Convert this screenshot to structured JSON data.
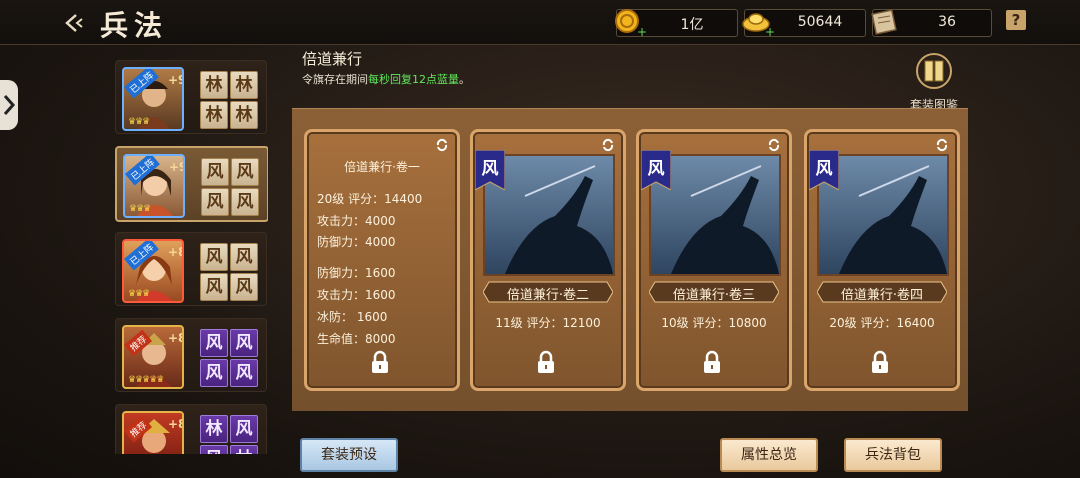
{
  "header": {
    "title": "兵法",
    "back_icon": "back-arrow-icon",
    "help_label": "?"
  },
  "currencies": [
    {
      "icon": "gold-coin-icon",
      "value": "1亿"
    },
    {
      "icon": "gold-ingot-icon",
      "value": "50644"
    },
    {
      "icon": "scroll-icon",
      "value": "36"
    }
  ],
  "heroes": [
    {
      "badge": "已上阵",
      "level": "+9",
      "stars": "♛♛♛",
      "frame": "blue",
      "tiles": [
        "林",
        "林",
        "林",
        "林"
      ],
      "tile_style": "gold"
    },
    {
      "badge": "已上阵",
      "level": "+9",
      "stars": "♛♛♛",
      "frame": "blue",
      "tiles": [
        "风",
        "风",
        "风",
        "风"
      ],
      "tile_style": "gold"
    },
    {
      "badge": "已上阵",
      "level": "+8",
      "stars": "♛♛♛",
      "frame": "red",
      "tiles": [
        "风",
        "风",
        "风",
        "风"
      ],
      "tile_style": "gold"
    },
    {
      "badge": "推荐",
      "level": "+8",
      "stars": "♛♛♛♛♛",
      "frame": "gold",
      "tiles": [
        "风",
        "风",
        "风",
        "风"
      ],
      "tile_style": "purple"
    },
    {
      "badge": "推荐",
      "level": "+8",
      "stars": "",
      "frame": "gold",
      "tiles": [
        "林",
        "风",
        "风",
        "林"
      ],
      "tile_style": "purple"
    }
  ],
  "set": {
    "name": "倍道兼行",
    "desc_prefix": "令旗存在期间",
    "desc_highlight": "每秒回复12点蓝量",
    "desc_suffix": "。",
    "catalog_label": "套装图鉴"
  },
  "cards": [
    {
      "title": "倍道兼行·卷一",
      "level_score": "20级  评分：14400",
      "stats": [
        "攻击力：4000",
        "防御力：4000"
      ],
      "stats2": [
        "防御力：1600",
        "攻击力：1600",
        "冰防：   1600",
        "生命值：8000"
      ]
    },
    {
      "title": "倍道兼行·卷二",
      "flag": "风",
      "level_score": "11级  评分：12100"
    },
    {
      "title": "倍道兼行·卷三",
      "flag": "风",
      "level_score": "10级  评分：10800"
    },
    {
      "title": "倍道兼行·卷四",
      "flag": "风",
      "level_score": "20级  评分：16400"
    }
  ],
  "buttons": {
    "preset": "套装预设",
    "overview": "属性总览",
    "bag": "兵法背包"
  },
  "colors": {
    "highlight": "#5fe85a",
    "accent": "#c9a46a"
  }
}
